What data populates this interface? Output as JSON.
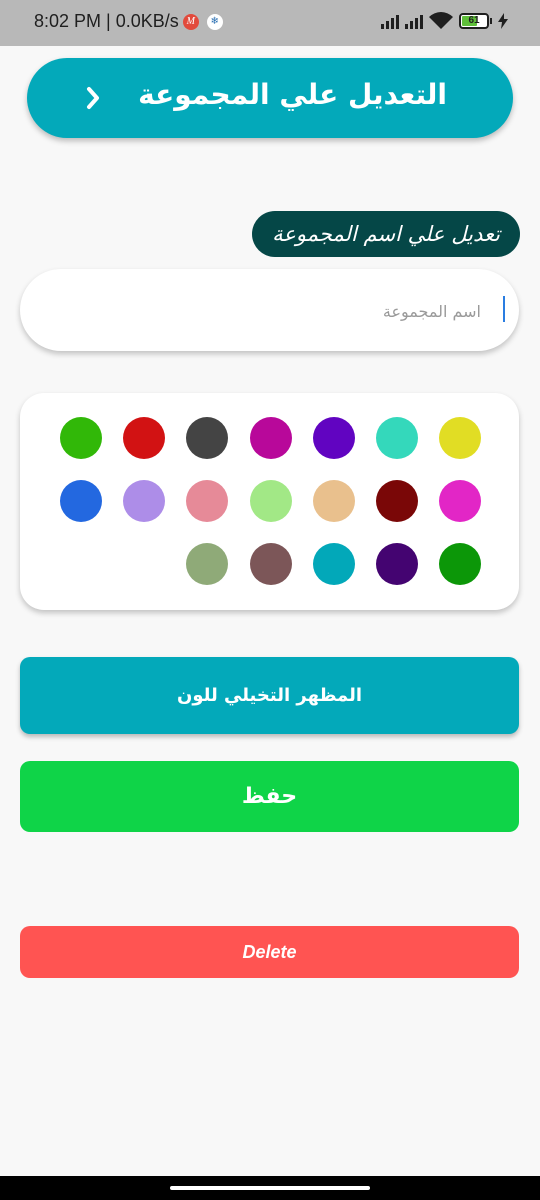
{
  "status_bar": {
    "time_speed": "8:02 PM | 0.0KB/s",
    "notif_m": "M",
    "notif_vpn": "❄",
    "battery_level": "61",
    "battery_fraction": 0.61
  },
  "header": {
    "title": "التعديل علي المجموعة",
    "back_icon": "chevron-right-icon",
    "color": "#03a9ba"
  },
  "section_label": "تعديل علي اسم المجموعة",
  "name_input": {
    "placeholder": "اسم المجموعة",
    "value": ""
  },
  "color_swatches": [
    "#e1dd24",
    "#34d8bb",
    "#6104c1",
    "#b8089a",
    "#444444",
    "#d21213",
    "#31b808",
    "#e226c6",
    "#7a0707",
    "#e9c08d",
    "#a2e886",
    "#e68a98",
    "#ad8de8",
    "#2368e0",
    "#0c9708",
    "#440471",
    "#02a8b9",
    "#7c5658",
    "#8faa78"
  ],
  "buttons": {
    "preview_label": "المظهر التخيلي للون",
    "save_label": "حفظ",
    "delete_label": "Delete"
  },
  "colors": {
    "accent": "#03a9ba",
    "save": "#0fd448",
    "delete": "#ff5452",
    "label_bg": "#054747"
  }
}
